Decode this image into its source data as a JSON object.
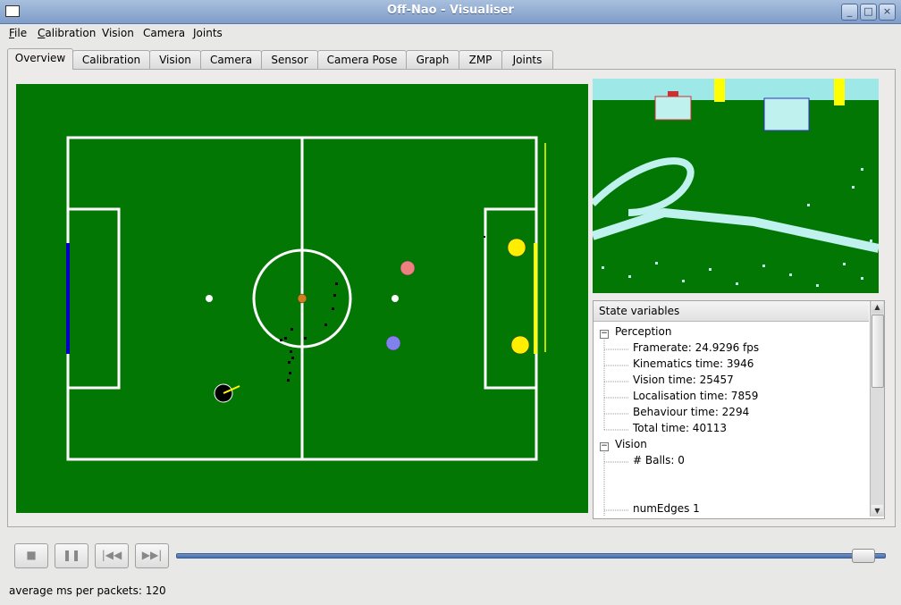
{
  "window": {
    "title": "Off-Nao - Visualiser",
    "controls": [
      "_",
      "□",
      "×"
    ]
  },
  "menubar": {
    "items": [
      {
        "label": "File"
      },
      {
        "label": "Calibration"
      },
      {
        "label": "Vision"
      },
      {
        "label": "Camera"
      },
      {
        "label": "Joints"
      }
    ]
  },
  "tabs": [
    {
      "label": "Overview",
      "active": true
    },
    {
      "label": "Calibration"
    },
    {
      "label": "Vision"
    },
    {
      "label": "Camera"
    },
    {
      "label": "Sensor"
    },
    {
      "label": "Camera Pose"
    },
    {
      "label": "Graph"
    },
    {
      "label": "ZMP"
    },
    {
      "label": "Joints"
    }
  ],
  "field": {
    "colors": {
      "grass": "#037703",
      "lines": "#ffffff",
      "blue_goal": "#0000c8",
      "yellow_goal": "#ffff00",
      "ball": "#d08018",
      "pink_robot": "#ee8080",
      "blue_robot": "#8080ee"
    }
  },
  "state_variables": {
    "header": "State variables",
    "groups": [
      {
        "name": "Perception",
        "expander": "−",
        "items": [
          "Framerate: 24.9296 fps",
          "Kinematics time: 3946",
          "Vision time: 25457",
          "Localisation time: 7859",
          "Behaviour time: 2294",
          "Total time: 40113"
        ]
      },
      {
        "name": "Vision",
        "expander": "−",
        "items": [
          "# Balls: 0",
          "",
          "",
          "numEdges 1"
        ]
      }
    ]
  },
  "playback": {
    "buttons": [
      {
        "name": "stop-icon",
        "glyph": "■"
      },
      {
        "name": "pause-icon",
        "glyph": "❚❚"
      },
      {
        "name": "rewind-icon",
        "glyph": "|◀◀"
      },
      {
        "name": "fast-forward-icon",
        "glyph": "▶▶|"
      }
    ],
    "position": 0.985
  },
  "status": {
    "text": "average ms per packets: 120"
  }
}
